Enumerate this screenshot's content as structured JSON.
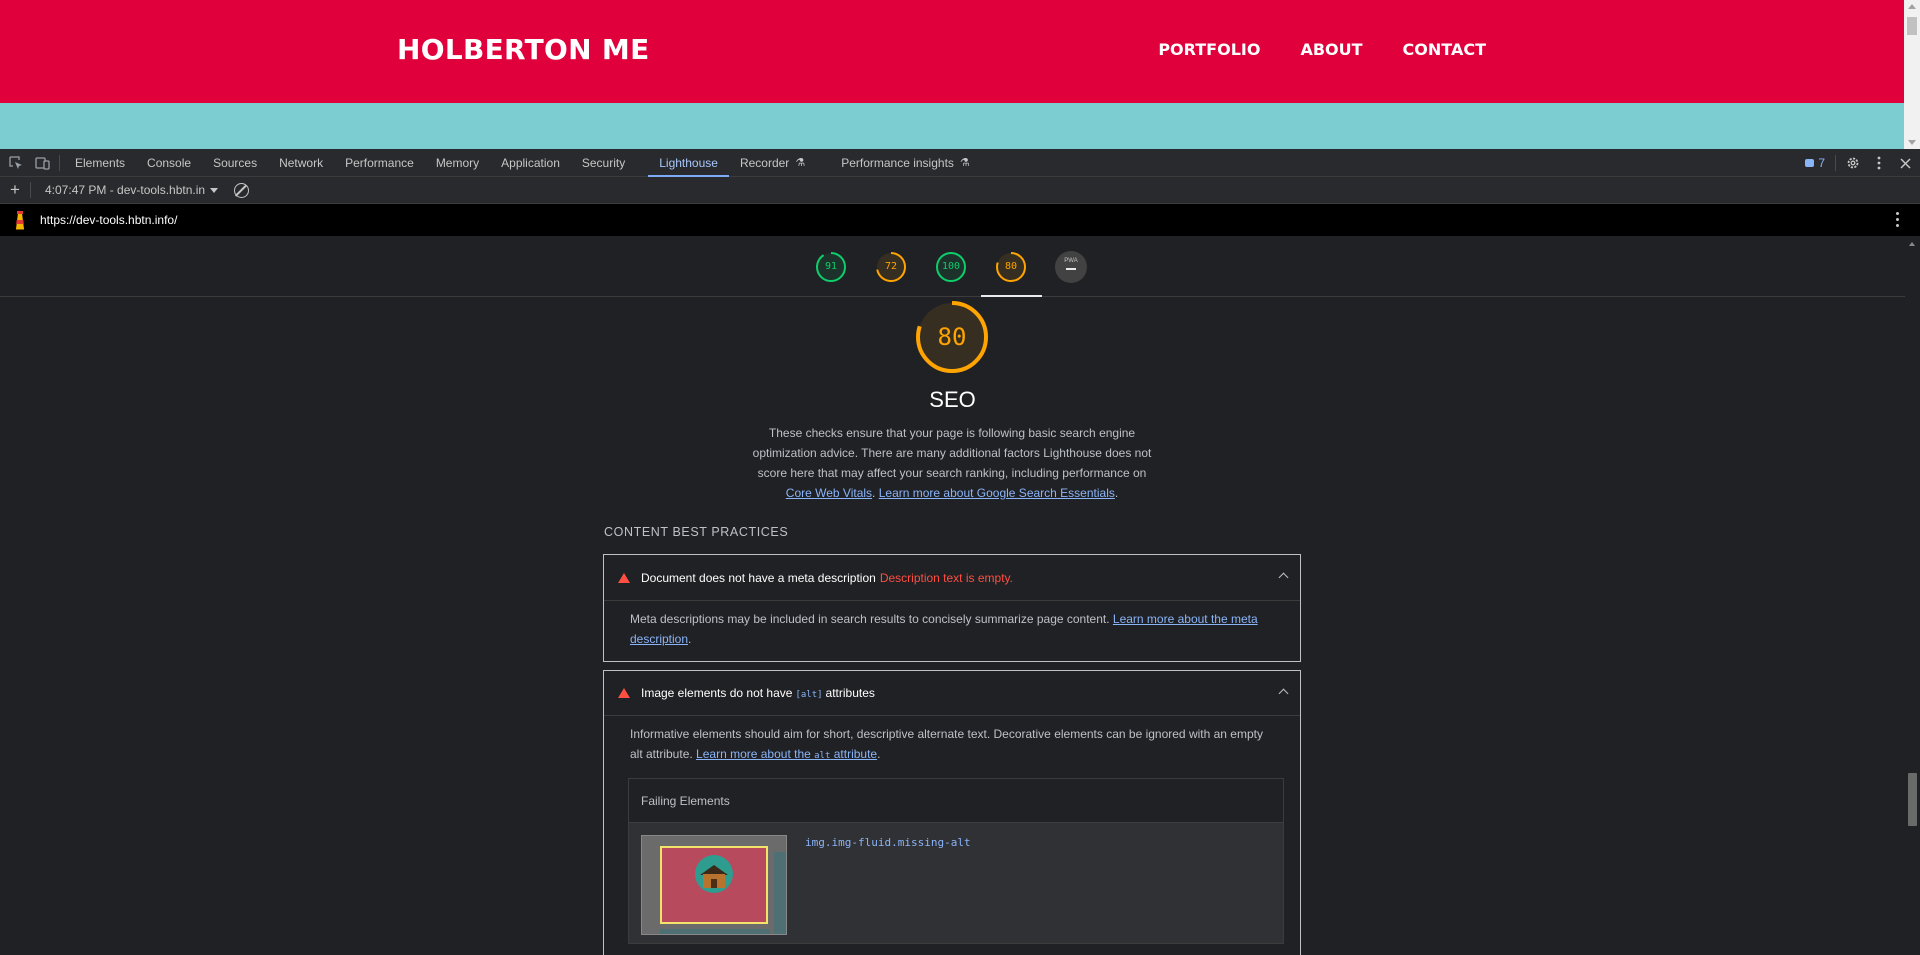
{
  "site": {
    "logo": "HOLBERTON ME",
    "nav": [
      "PORTFOLIO",
      "ABOUT",
      "CONTACT"
    ],
    "colors": {
      "header": "#e0003c",
      "body": "#7ccdd1"
    }
  },
  "devtools": {
    "tabs": [
      "Elements",
      "Console",
      "Sources",
      "Network",
      "Performance",
      "Memory",
      "Application",
      "Security",
      "Lighthouse",
      "Recorder",
      "Performance insights"
    ],
    "active_tab": "Lighthouse",
    "issues_count": "7",
    "icons": [
      "inspect-icon",
      "device-toggle-icon",
      "settings-icon",
      "more-icon",
      "close-icon"
    ]
  },
  "lighthouse": {
    "report_label": "4:07:47 PM - dev-tools.hbtn.in",
    "url": "https://dev-tools.hbtn.info/",
    "scores": [
      {
        "value": "91",
        "score": 0.91,
        "color": "#0cce6b"
      },
      {
        "value": "72",
        "score": 0.72,
        "color": "#ffa400"
      },
      {
        "value": "100",
        "score": 1.0,
        "color": "#0cce6b"
      },
      {
        "value": "80",
        "score": 0.8,
        "color": "#ffa400"
      },
      {
        "value": "PWA",
        "score": null,
        "color": "#9aa0a6"
      }
    ],
    "category": {
      "score": "80",
      "score_fraction": 0.8,
      "title": "SEO",
      "desc_1": "These checks ensure that your page is following basic search engine optimization advice. There are many additional factors Lighthouse does not score here that may affect your search ranking, including performance on ",
      "link_1": "Core Web Vitals",
      "desc_sep": ". ",
      "link_2": "Learn more about Google Search Essentials",
      "desc_end": "."
    },
    "group_title": "CONTENT BEST PRACTICES",
    "audits": [
      {
        "title": "Document does not have a meta description",
        "display_value": "Description text is empty.",
        "desc": "Meta descriptions may be included in search results to concisely summarize page content. ",
        "link": "Learn more about the meta description",
        "desc_end": "."
      },
      {
        "title_pre": "Image elements do not have",
        "title_code": "[alt]",
        "title_post": "attributes",
        "desc": "Informative elements should aim for short, descriptive alternate text. Decorative elements can be ignored with an empty alt attribute. ",
        "link_pre": "Learn more about the ",
        "link_code": "alt",
        "link_post": " attribute",
        "desc_end": ".",
        "table_header": "Failing Elements",
        "failing_selector": "img.img-fluid.missing-alt"
      }
    ]
  }
}
